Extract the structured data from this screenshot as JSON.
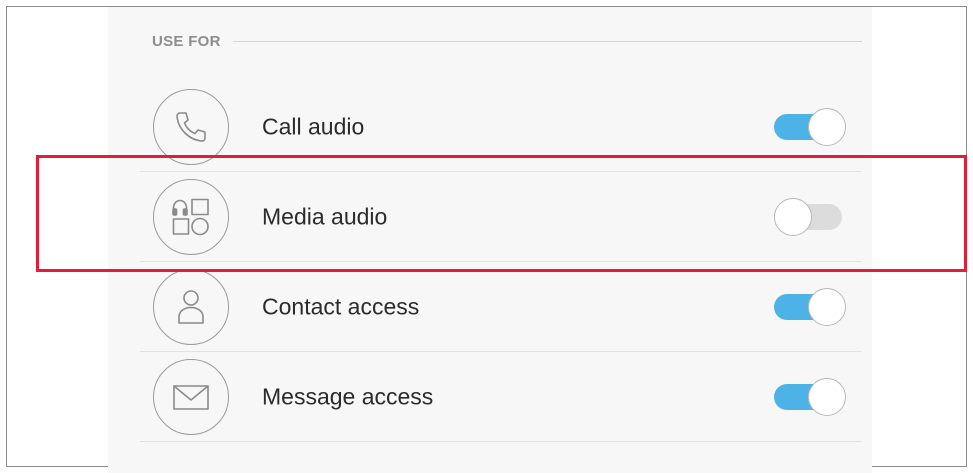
{
  "section": {
    "title": "USE FOR"
  },
  "items": [
    {
      "label": "Call audio",
      "icon": "phone-icon",
      "enabled": true
    },
    {
      "label": "Media audio",
      "icon": "media-apps-icon",
      "enabled": false
    },
    {
      "label": "Contact access",
      "icon": "person-icon",
      "enabled": true
    },
    {
      "label": "Message access",
      "icon": "envelope-icon",
      "enabled": true
    }
  ],
  "colors": {
    "toggle_on": "#4db2e5",
    "toggle_off": "#dcdcdc",
    "highlight": "#e11d38"
  }
}
